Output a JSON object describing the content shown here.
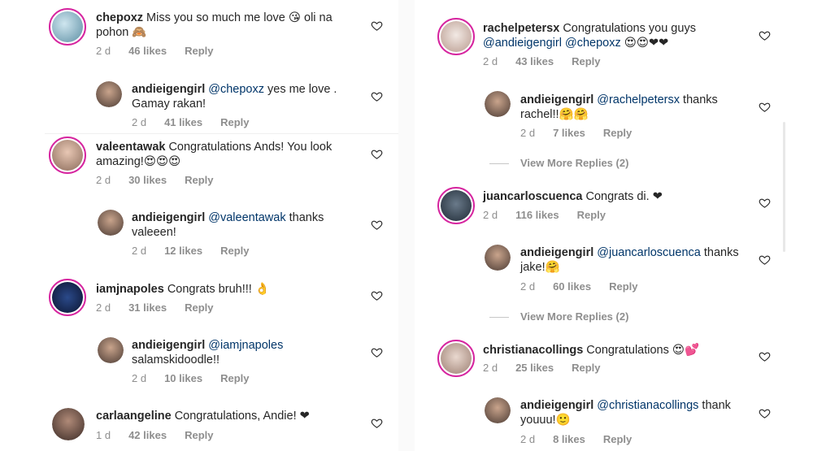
{
  "left_column": [
    {
      "username": "chepoxz",
      "text": "Miss you so much me love 😘 oli na pohon 🙈",
      "time": "2 d",
      "likes": "46 likes",
      "reply_label": "Reply",
      "reply": {
        "username": "andieigengirl",
        "mention": "@chepoxz",
        "text": " yes me love . Gamay rakan!",
        "time": "2 d",
        "likes": "41 likes",
        "reply_label": "Reply"
      }
    },
    {
      "username": "valeentawak",
      "text": "Congratulations Ands! You look amazing!😍😍😍",
      "time": "2 d",
      "likes": "30 likes",
      "reply_label": "Reply",
      "reply": {
        "username": "andieigengirl",
        "mention": "@valeentawak",
        "text": " thanks valeeen!",
        "time": "2 d",
        "likes": "12 likes",
        "reply_label": "Reply"
      }
    },
    {
      "username": "iamjnapoles",
      "text": "Congrats bruh!!! 👌",
      "time": "2 d",
      "likes": "31 likes",
      "reply_label": "Reply",
      "reply": {
        "username": "andieigengirl",
        "mention": "@iamjnapoles",
        "text": " salamskidoodle!!",
        "time": "2 d",
        "likes": "10 likes",
        "reply_label": "Reply"
      }
    },
    {
      "username": "carlaangeline",
      "text": "Congratulations, Andie! ❤",
      "time": "1 d",
      "likes": "42 likes",
      "reply_label": "Reply"
    }
  ],
  "right_column": [
    {
      "username": "rachelpetersx",
      "text": "Congratulations you guys",
      "mentions": "@andieigengirl @chepoxz",
      "emojis": " 😍😍❤❤",
      "time": "2 d",
      "likes": "43 likes",
      "reply_label": "Reply",
      "reply": {
        "username": "andieigengirl",
        "mention": "@rachelpetersx",
        "text": " thanks rachel!!🤗🤗",
        "time": "2 d",
        "likes": "7 likes",
        "reply_label": "Reply"
      },
      "view_more": "View More Replies (2)"
    },
    {
      "username": "juancarloscuenca",
      "text": "Congrats di. ❤",
      "time": "2 d",
      "likes": "116 likes",
      "reply_label": "Reply",
      "reply": {
        "username": "andieigengirl",
        "mention": "@juancarloscuenca",
        "text": " thanks jake!🤗",
        "time": "2 d",
        "likes": "60 likes",
        "reply_label": "Reply"
      },
      "view_more": "View More Replies (2)"
    },
    {
      "username": "christianacollings",
      "text": "Congratulations 😍💕",
      "time": "2 d",
      "likes": "25 likes",
      "reply_label": "Reply",
      "reply": {
        "username": "andieigengirl",
        "mention": "@christianacollings",
        "text": " thank youuu!🙂",
        "time": "2 d",
        "likes": "8 likes",
        "reply_label": "Reply"
      }
    }
  ],
  "colors": {
    "text": "#262626",
    "meta": "#8e8e8e",
    "mention": "#003569",
    "story_ring": "#d6249f"
  }
}
